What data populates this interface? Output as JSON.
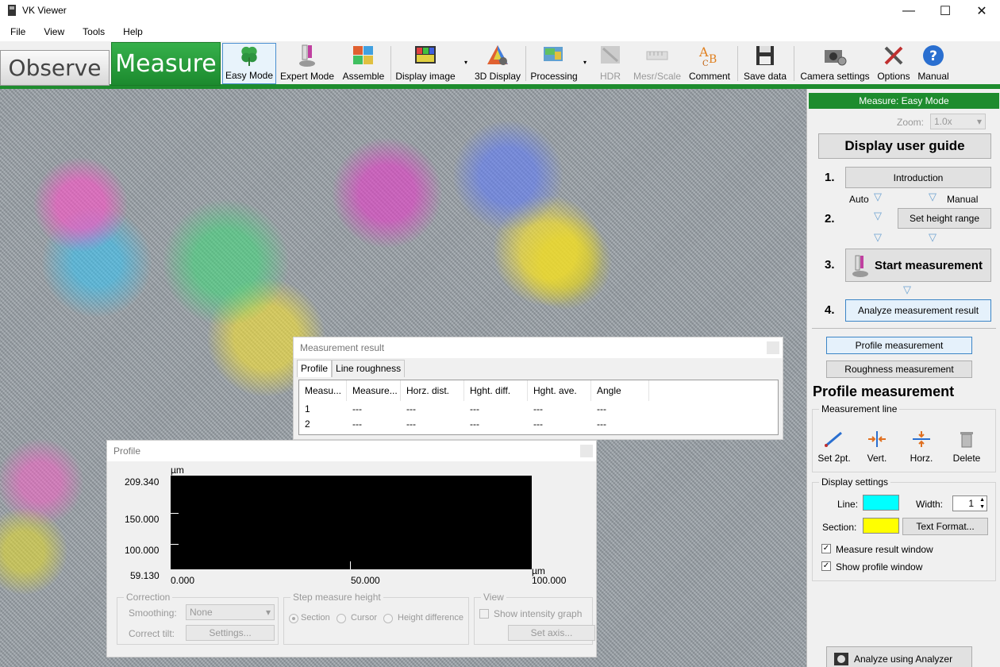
{
  "window": {
    "title": "VK Viewer",
    "minimize_glyph": "—",
    "maximize_glyph": "☐",
    "close_glyph": "✕"
  },
  "menu": [
    "File",
    "View",
    "Tools",
    "Help"
  ],
  "tabs": {
    "observe": "Observe",
    "measure": "Measure"
  },
  "toolbar": {
    "easy_mode": "Easy Mode",
    "expert_mode": "Expert Mode",
    "assemble": "Assemble",
    "display_image": "Display image",
    "display_3d": "3D Display",
    "processing": "Processing",
    "hdr": "HDR",
    "mesr_scale": "Mesr/Scale",
    "comment": "Comment",
    "save_data": "Save data",
    "camera_settings": "Camera settings",
    "options": "Options",
    "manual": "Manual",
    "dropdown_glyph": "▾"
  },
  "measurement_result": {
    "title": "Measurement result",
    "tabs": [
      "Profile",
      "Line roughness"
    ],
    "columns": [
      "Measu...",
      "Measure...",
      "Horz. dist.",
      "Hght. diff.",
      "Hght. ave.",
      "Angle"
    ],
    "rows": [
      [
        "1",
        "---",
        "---",
        "---",
        "---",
        "---"
      ],
      [
        "2",
        "---",
        "---",
        "---",
        "---",
        "---"
      ]
    ]
  },
  "profile": {
    "title": "Profile",
    "y_unit": "µm",
    "x_unit": "µm",
    "y_labels": [
      "209.340",
      "150.000",
      "100.000",
      "59.130"
    ],
    "x_labels": [
      "0.000",
      "50.000",
      "100.000"
    ],
    "correction": {
      "title": "Correction",
      "smoothing_label": "Smoothing:",
      "smoothing_value": "None",
      "tilt_label": "Correct tilt:",
      "settings_button": "Settings..."
    },
    "step": {
      "title": "Step measure height",
      "options": [
        "Section",
        "Cursor",
        "Height difference"
      ]
    },
    "view": {
      "title": "View",
      "intensity_label": "Show intensity graph",
      "set_axis": "Set axis..."
    }
  },
  "panel": {
    "header": "Measure: Easy Mode",
    "zoom_label": "Zoom:",
    "zoom_value": "1.0x",
    "user_guide": "Display user guide",
    "step_numbers": [
      "1.",
      "2.",
      "3.",
      "4."
    ],
    "introduction": "Introduction",
    "auto_label": "Auto",
    "manual_label": "Manual",
    "set_height_range": "Set height range",
    "start_measurement": "Start measurement",
    "analyze_result": "Analyze measurement result",
    "profile_measurement_btn": "Profile measurement",
    "roughness_measurement_btn": "Roughness measurement",
    "profile_heading": "Profile measurement",
    "measurement_line": "Measurement line",
    "tools": [
      "Set 2pt.",
      "Vert.",
      "Horz.",
      "Delete"
    ],
    "display_settings": "Display settings",
    "line_label": "Line:",
    "line_color": "#00ffff",
    "width_label": "Width:",
    "width_value": "1",
    "section_label": "Section:",
    "section_color": "#ffff00",
    "text_format": "Text Format...",
    "measure_result_window": "Measure result window",
    "show_profile_window": "Show profile window",
    "analyze_analyzer": "Analyze using Analyzer",
    "tri_glyph": "▽",
    "check_glyph": "✓"
  }
}
